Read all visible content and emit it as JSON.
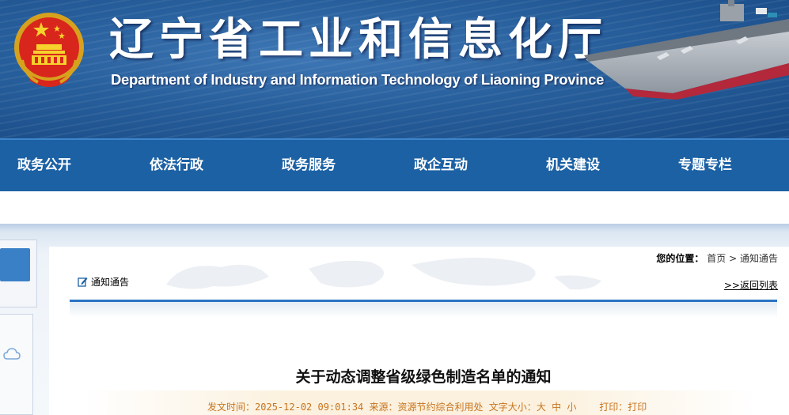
{
  "header": {
    "title": "辽宁省工业和信息化厅",
    "subtitle": "Department of Industry and Information Technology of Liaoning Province"
  },
  "nav": {
    "items": [
      {
        "label": "政务公开"
      },
      {
        "label": "依法行政"
      },
      {
        "label": "政务服务"
      },
      {
        "label": "政企互动"
      },
      {
        "label": "机关建设"
      },
      {
        "label": "专题专栏"
      }
    ]
  },
  "breadcrumb": {
    "label": "您的位置：",
    "home": "首页",
    "separator": ">",
    "current": "通知通告"
  },
  "section": {
    "title": "通知通告",
    "back_link": ">>返回列表"
  },
  "article": {
    "title": "关于动态调整省级绿色制造名单的通知",
    "publish_label": "发文时间：",
    "publish_time": "2025-12-02 09:01:34",
    "source_label": "来源：",
    "source": "资源节约综合利用处",
    "font_size_label": "文字大小：",
    "font_large": "大",
    "font_medium": "中",
    "font_small": "小",
    "print_label": "打印：",
    "print_link": "打印"
  },
  "colors": {
    "nav_bg": "#1c61a4",
    "accent_rule": "#2a74c3",
    "meta_text": "#c8741e"
  }
}
